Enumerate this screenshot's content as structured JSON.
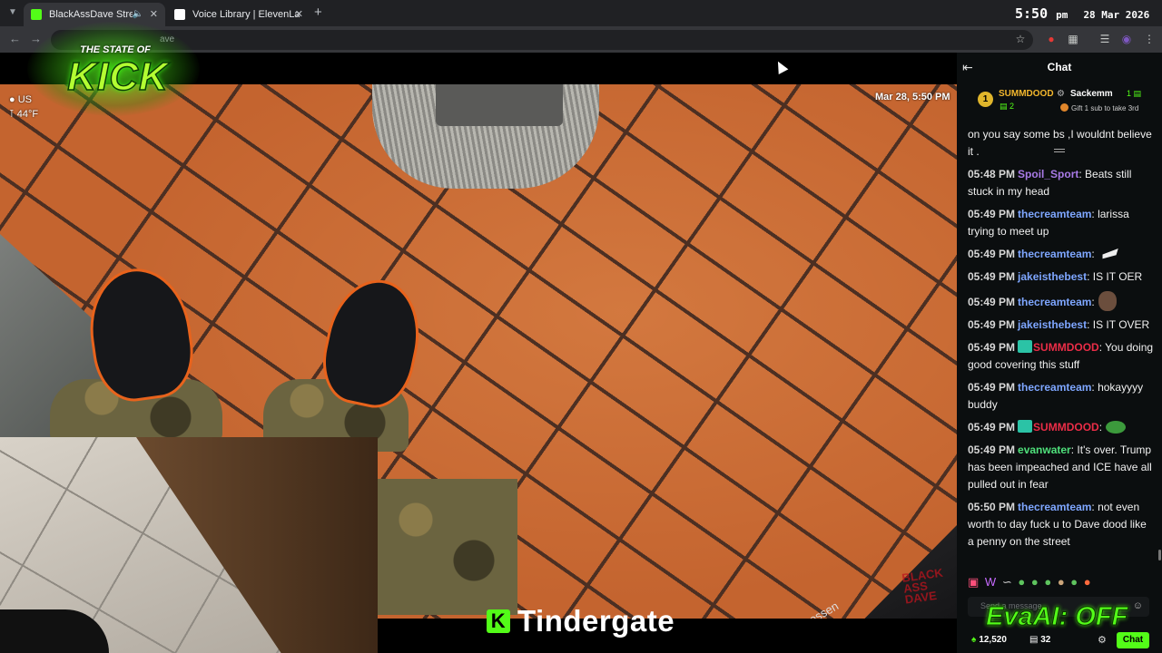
{
  "browser": {
    "tabs": [
      {
        "title": "BlackAssDave Stream - Wat",
        "active": true
      },
      {
        "title": "Voice Library | ElevenLabs",
        "active": false
      }
    ],
    "url": "ave",
    "clock": {
      "time": "5:50",
      "ampm": "pm",
      "date": "28 Mar 2026"
    }
  },
  "stream": {
    "logo_top": "THE STATE OF",
    "logo_main": "KICK",
    "weather_location": "US",
    "temperature": "44°F",
    "timestamp": "Mar 28, 5:50 PM",
    "caption": "Tindergate",
    "caption_badge": "K",
    "bag_text": "essen",
    "watermark": "BLACK ASS DAVE"
  },
  "chat": {
    "title": "Chat",
    "pinned": {
      "rank": "1",
      "top_user": "SUMMDOOD",
      "top_count": "2",
      "gift_user": "Sackemm",
      "gift_count": "1",
      "gift_note": "Gift 1 sub to take 3rd"
    },
    "messages": [
      {
        "time": "",
        "user": "",
        "text": "on you say some bs ,I wouldnt believe it ."
      },
      {
        "time": "05:48 PM",
        "user": "Spoil_Sport",
        "text": ": Beats still stuck in my head"
      },
      {
        "time": "05:49 PM",
        "user": "thecreamteam",
        "text": ": larissa trying to meet up"
      },
      {
        "time": "05:49 PM",
        "user": "thecreamteam",
        "text": ":"
      },
      {
        "time": "05:49 PM",
        "user": "jakeisthebest",
        "text": ": IS IT OER"
      },
      {
        "time": "05:49 PM",
        "user": "thecreamteam",
        "text": ":"
      },
      {
        "time": "05:49 PM",
        "user": "jakeisthebest",
        "text": ": IS IT OVER"
      },
      {
        "time": "05:49 PM",
        "user": "SUMMDOOD",
        "text": ": You doing good covering this stuff"
      },
      {
        "time": "05:49 PM",
        "user": "thecreamteam",
        "text": ": hokayyyy buddy"
      },
      {
        "time": "05:49 PM",
        "user": "SUMMDOOD",
        "text": ":"
      },
      {
        "time": "05:49 PM",
        "user": "evanwater",
        "text": ": It's over. Trump has been impeached and ICE have all pulled out in fear"
      },
      {
        "time": "05:50 PM",
        "user": "thecreamteam",
        "text": ": not even worth to day fuck u to Dave dood like a penny on the street"
      }
    ],
    "input_placeholder": "Send a message",
    "overlay_text": "EvaAI: OFF",
    "viewers": "12,520",
    "gift_subs": "32",
    "chat_button": "Chat"
  },
  "colors": {
    "kick_green": "#53fc18",
    "chat_bg": "#0b0e0f",
    "browser_bg": "#202124",
    "floor_orange": "#c4642f"
  }
}
